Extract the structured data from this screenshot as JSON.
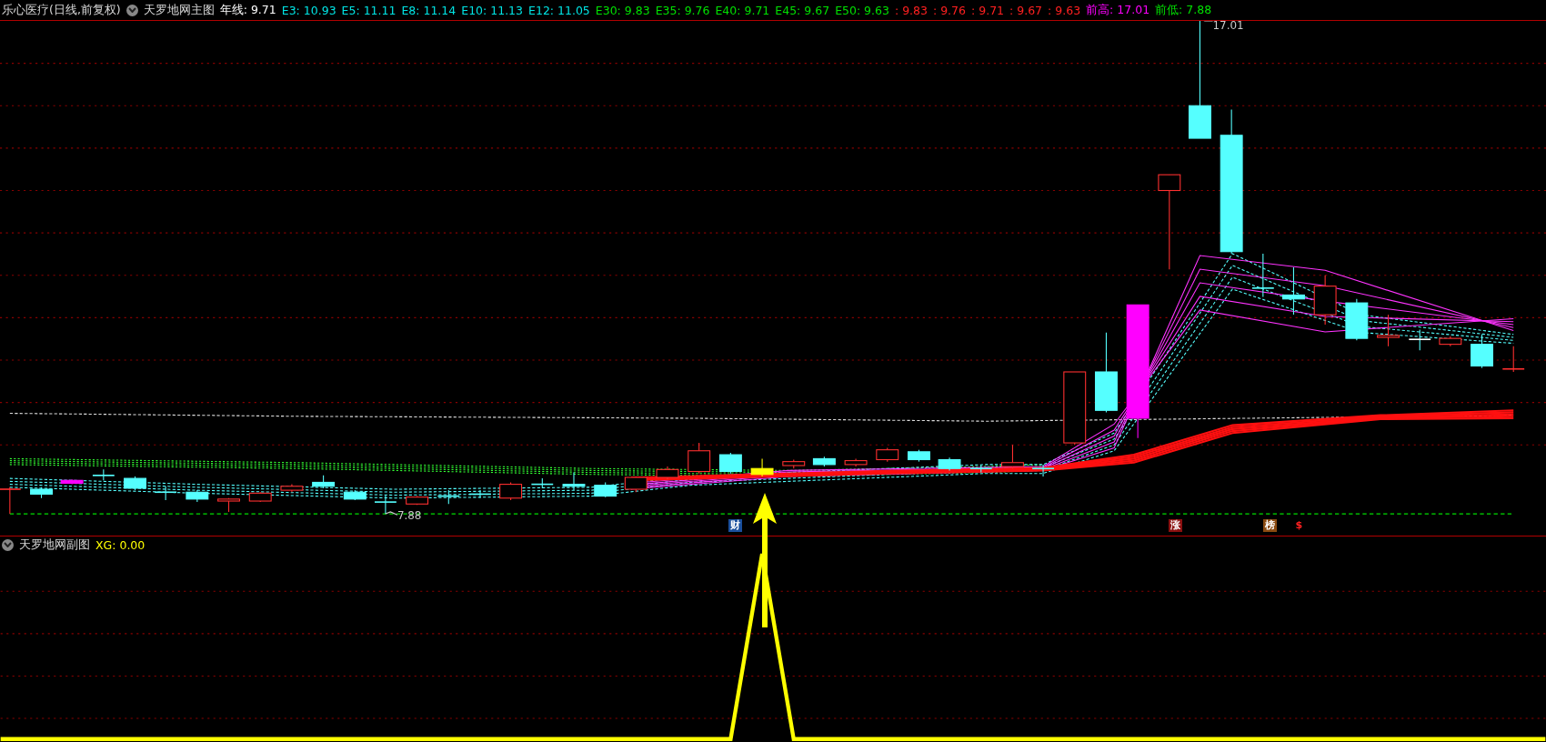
{
  "main_panel": {
    "stock_title": "乐心医疗(日线,前复权)",
    "indicator_name": "天罗地网主图",
    "values": [
      {
        "text": "年线: 9.71",
        "color": "#ffffff"
      },
      {
        "text": "E3: 10.93",
        "color": "#00e5e5"
      },
      {
        "text": "E5: 11.11",
        "color": "#00e5e5"
      },
      {
        "text": "E8: 11.14",
        "color": "#00e5e5"
      },
      {
        "text": "E10: 11.13",
        "color": "#00e5e5"
      },
      {
        "text": "E12: 11.05",
        "color": "#00e5e5"
      },
      {
        "text": "E30: 9.83",
        "color": "#00e000"
      },
      {
        "text": "E35: 9.76",
        "color": "#00e000"
      },
      {
        "text": "E40: 9.71",
        "color": "#00e000"
      },
      {
        "text": "E45: 9.67",
        "color": "#00e000"
      },
      {
        "text": "E50: 9.63",
        "color": "#00e000"
      },
      {
        "text": ": 9.83",
        "color": "#ff2020"
      },
      {
        "text": ": 9.76",
        "color": "#ff2020"
      },
      {
        "text": ": 9.71",
        "color": "#ff2020"
      },
      {
        "text": ": 9.67",
        "color": "#ff2020"
      },
      {
        "text": ": 9.63",
        "color": "#ff2020"
      },
      {
        "text": "前高: 17.01",
        "color": "#ff00ff"
      },
      {
        "text": "前低: 7.88",
        "color": "#00e000"
      }
    ],
    "high_label": "17.01",
    "low_label": "7.88",
    "signals": [
      {
        "text": "财",
        "color": "#1a4f9c"
      },
      {
        "text": "涨",
        "color": "#8a1010"
      },
      {
        "text": "榜",
        "color": "#8a4a10"
      },
      {
        "text": "$",
        "color": "#000000"
      }
    ]
  },
  "sub_panel": {
    "indicator_name": "天罗地网副图",
    "values": [
      {
        "text": "XG: 0.00",
        "color": "#ffff00"
      }
    ]
  }
}
